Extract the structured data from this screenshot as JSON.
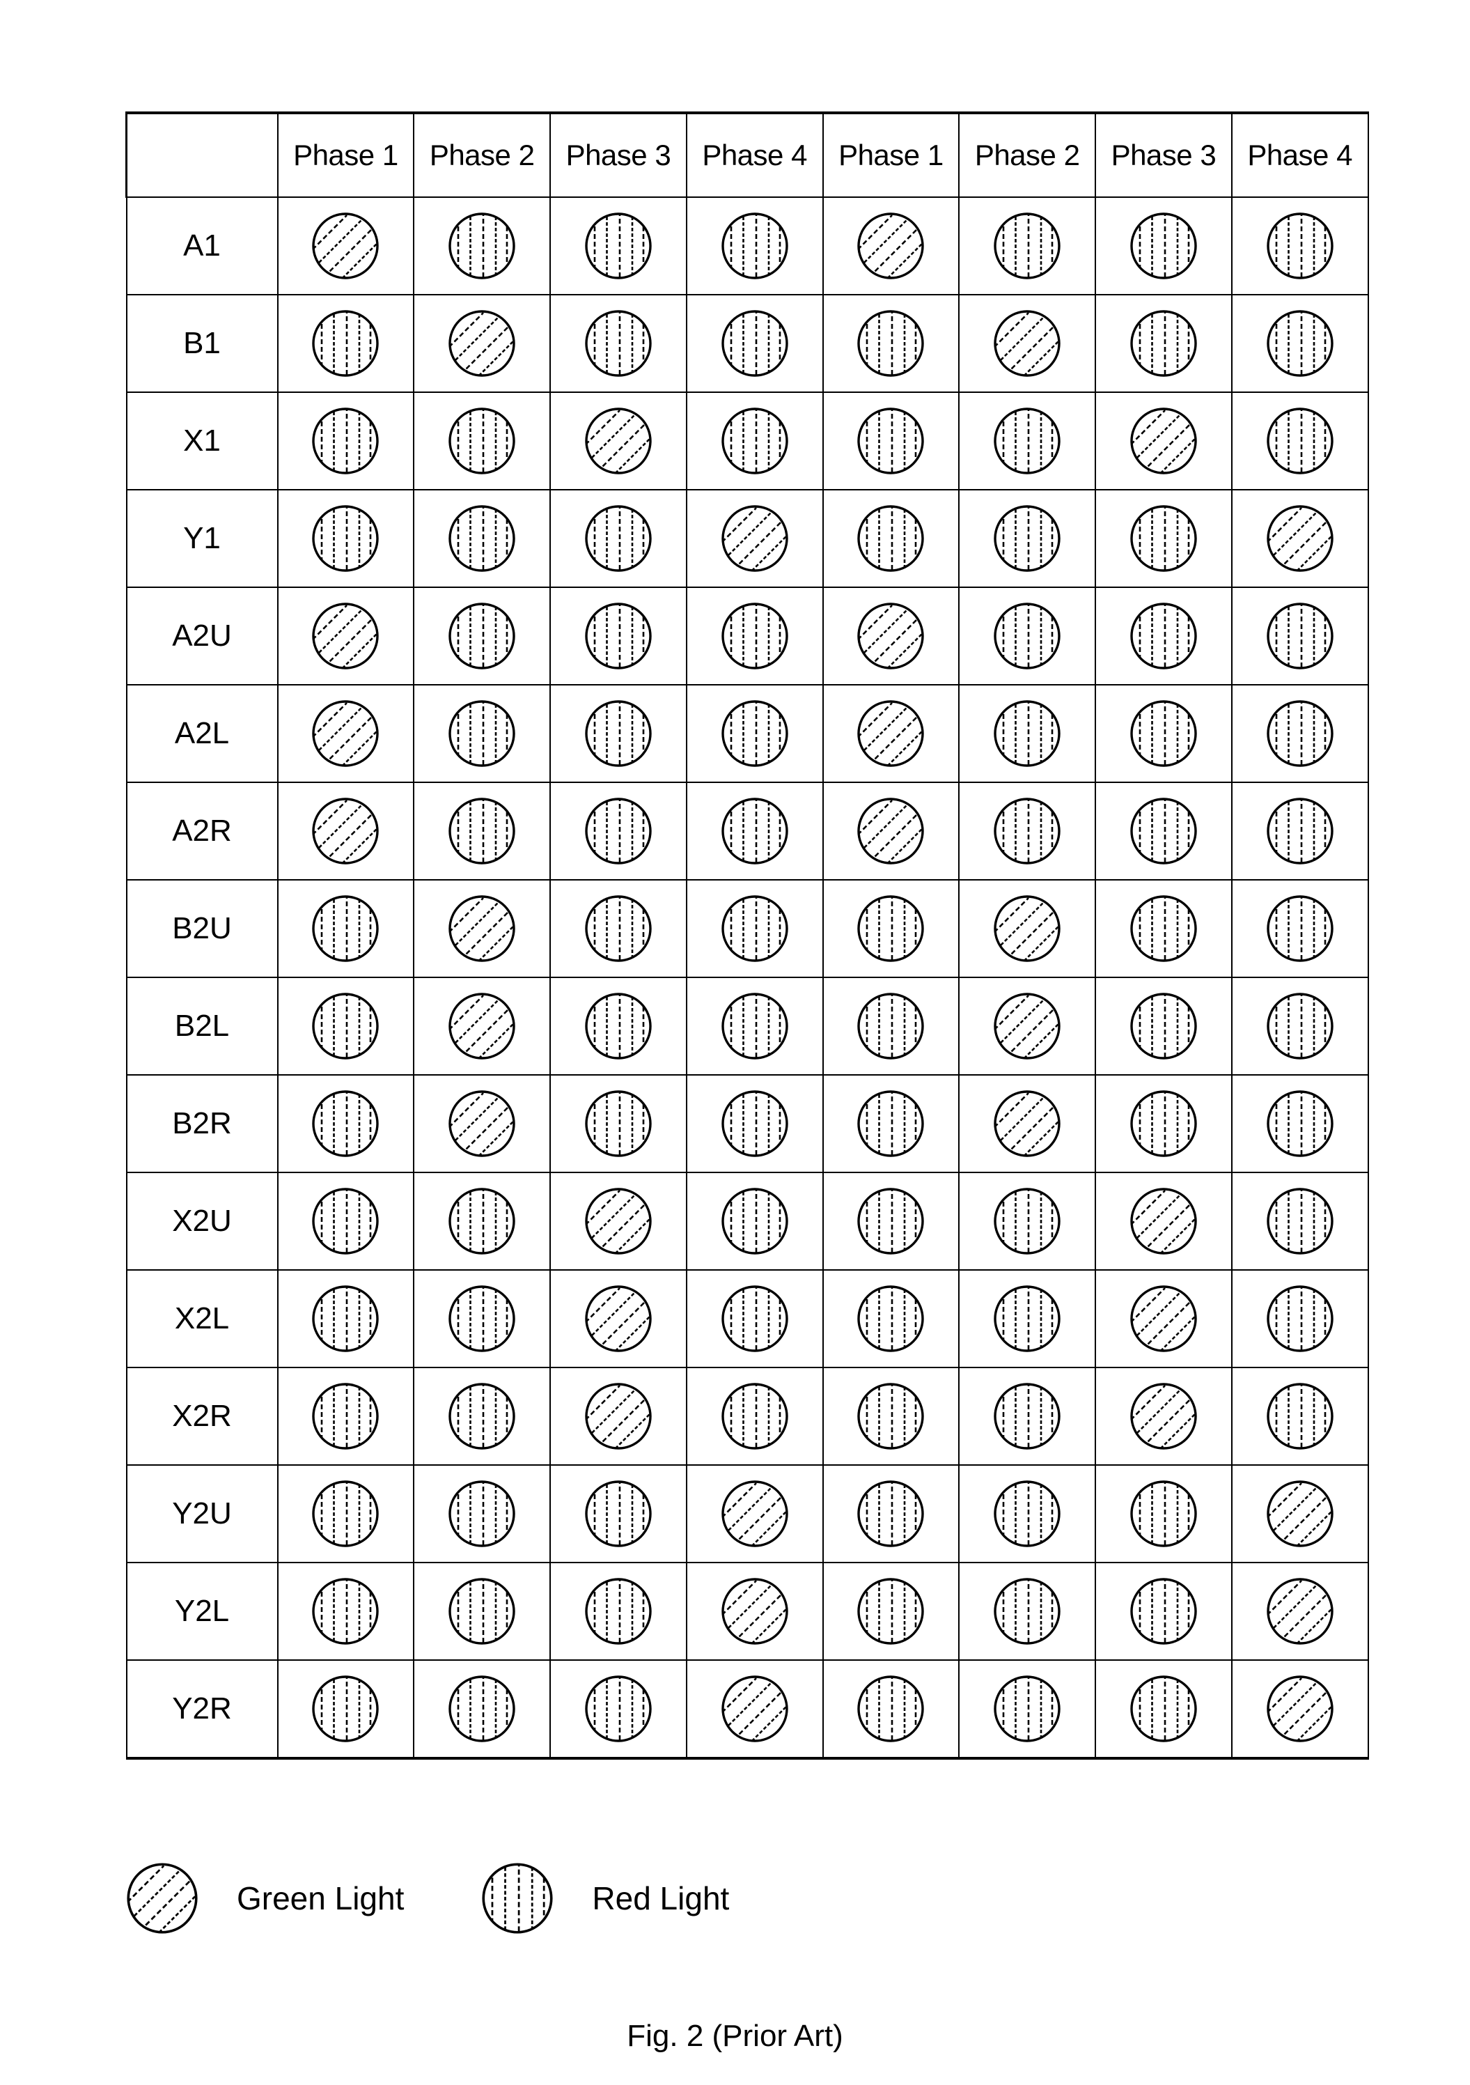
{
  "figure": {
    "caption": "Fig. 2 (Prior Art)"
  },
  "table": {
    "corner_header": "",
    "column_headers": [
      "Phase 1",
      "Phase 2",
      "Phase 3",
      "Phase 4",
      "Phase 1",
      "Phase 2",
      "Phase 3",
      "Phase 4"
    ],
    "row_labels": [
      "A1",
      "B1",
      "X1",
      "Y1",
      "A2U",
      "A2L",
      "A2R",
      "B2U",
      "B2L",
      "B2R",
      "X2U",
      "X2L",
      "X2R",
      "Y2U",
      "Y2L",
      "Y2R"
    ],
    "cell_states": [
      [
        "green",
        "red",
        "red",
        "red",
        "green",
        "red",
        "red",
        "red"
      ],
      [
        "red",
        "green",
        "red",
        "red",
        "red",
        "green",
        "red",
        "red"
      ],
      [
        "red",
        "red",
        "green",
        "red",
        "red",
        "red",
        "green",
        "red"
      ],
      [
        "red",
        "red",
        "red",
        "green",
        "red",
        "red",
        "red",
        "green"
      ],
      [
        "green",
        "red",
        "red",
        "red",
        "green",
        "red",
        "red",
        "red"
      ],
      [
        "green",
        "red",
        "red",
        "red",
        "green",
        "red",
        "red",
        "red"
      ],
      [
        "green",
        "red",
        "red",
        "red",
        "green",
        "red",
        "red",
        "red"
      ],
      [
        "red",
        "green",
        "red",
        "red",
        "red",
        "green",
        "red",
        "red"
      ],
      [
        "red",
        "green",
        "red",
        "red",
        "red",
        "green",
        "red",
        "red"
      ],
      [
        "red",
        "green",
        "red",
        "red",
        "red",
        "green",
        "red",
        "red"
      ],
      [
        "red",
        "red",
        "green",
        "red",
        "red",
        "red",
        "green",
        "red"
      ],
      [
        "red",
        "red",
        "green",
        "red",
        "red",
        "red",
        "green",
        "red"
      ],
      [
        "red",
        "red",
        "green",
        "red",
        "red",
        "red",
        "green",
        "red"
      ],
      [
        "red",
        "red",
        "red",
        "green",
        "red",
        "red",
        "red",
        "green"
      ],
      [
        "red",
        "red",
        "red",
        "green",
        "red",
        "red",
        "red",
        "green"
      ],
      [
        "red",
        "red",
        "red",
        "green",
        "red",
        "red",
        "red",
        "green"
      ]
    ]
  },
  "legend": {
    "items": [
      {
        "state": "green",
        "label": "Green Light",
        "icon": "green-light-icon"
      },
      {
        "state": "red",
        "label": "Red Light",
        "icon": "red-light-icon"
      }
    ]
  },
  "colors": {
    "stroke": "#000000",
    "background": "#ffffff"
  }
}
